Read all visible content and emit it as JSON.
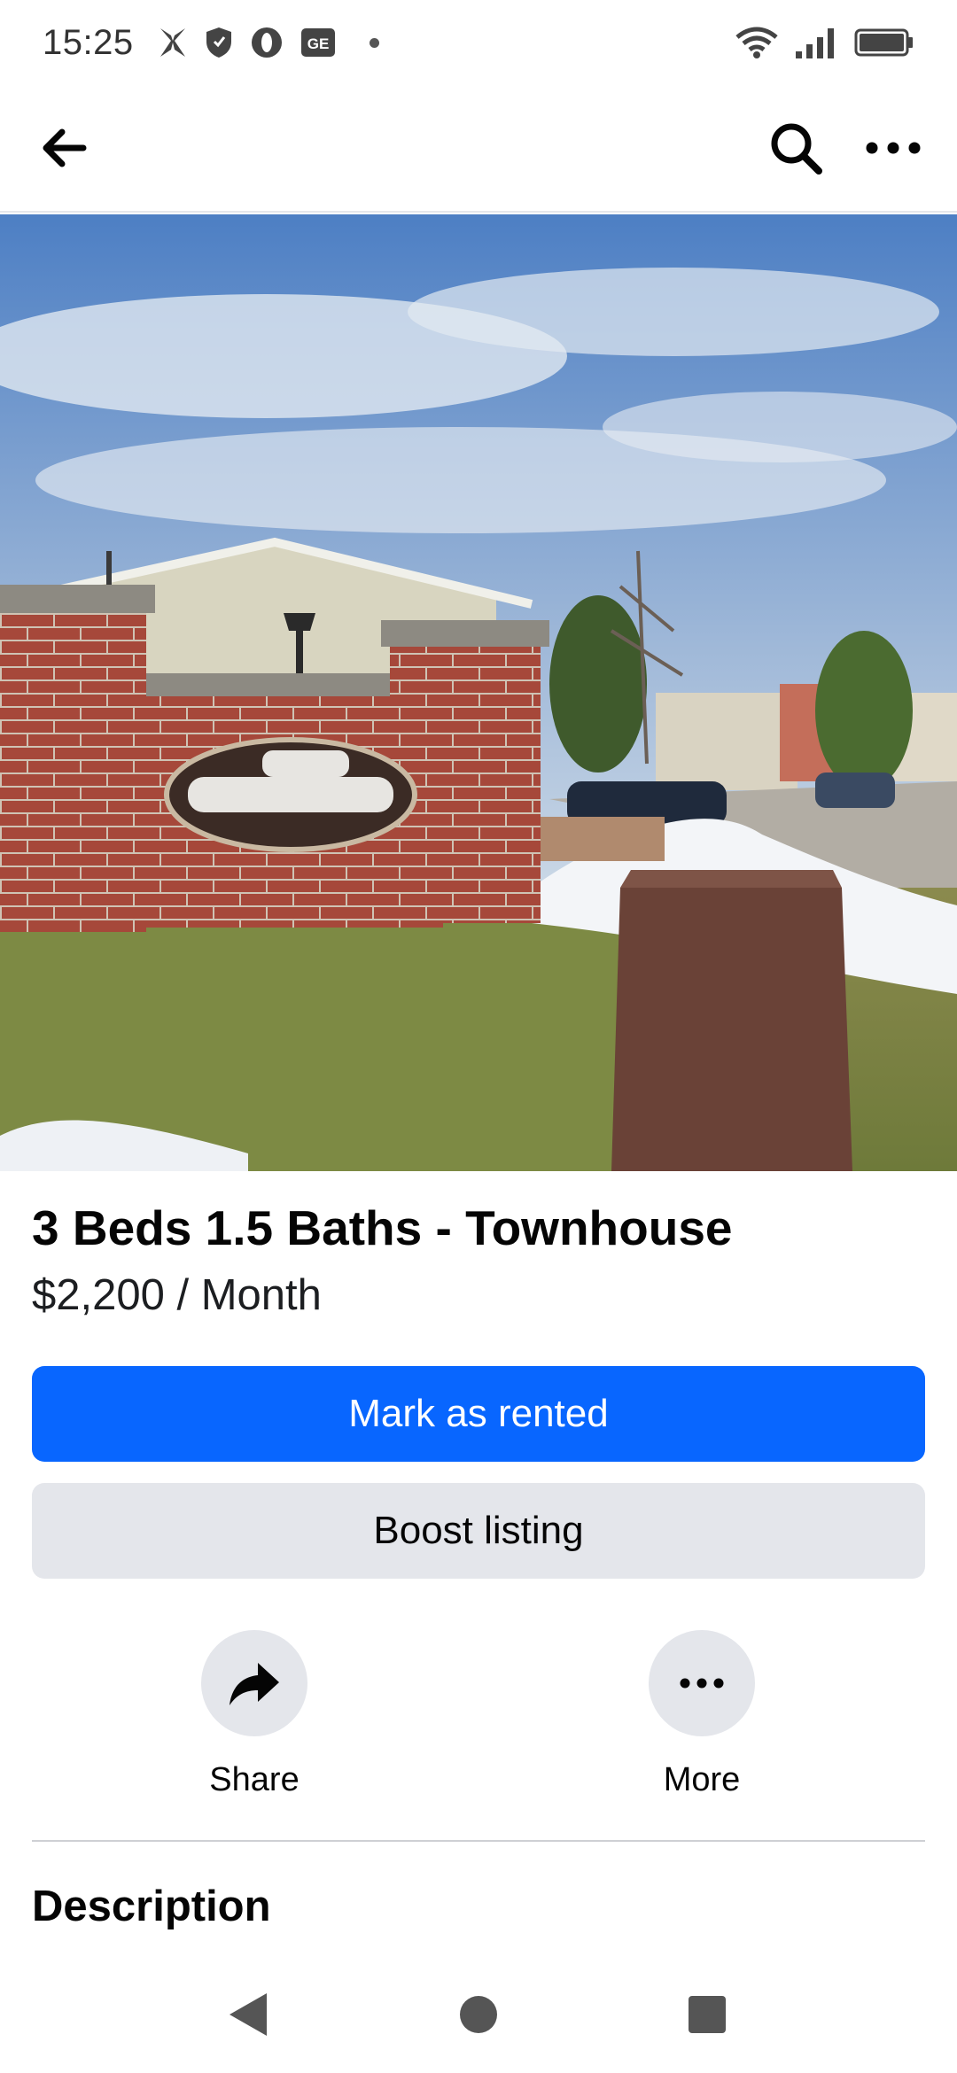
{
  "status_bar": {
    "time": "15:25",
    "left_icons": [
      "butterfly-icon",
      "shield-icon",
      "opera-icon",
      "ge-icon"
    ],
    "right_icons": [
      "wifi-icon",
      "signal-icon",
      "battery-icon"
    ]
  },
  "header": {
    "back_icon": "arrow-left-icon",
    "search_icon": "search-icon",
    "more_icon": "more-horizontal-icon"
  },
  "listing": {
    "title": "3 Beds 1.5 Baths - Townhouse",
    "price": "$2,200 / Month"
  },
  "buttons": {
    "mark_as_rented": "Mark as rented",
    "boost_listing": "Boost listing"
  },
  "actions": {
    "share": "Share",
    "more": "More"
  },
  "section": {
    "description_title": "Description"
  },
  "colors": {
    "primary": "#0866ff",
    "secondary_bg": "#e4e6eb",
    "text": "#050505"
  }
}
